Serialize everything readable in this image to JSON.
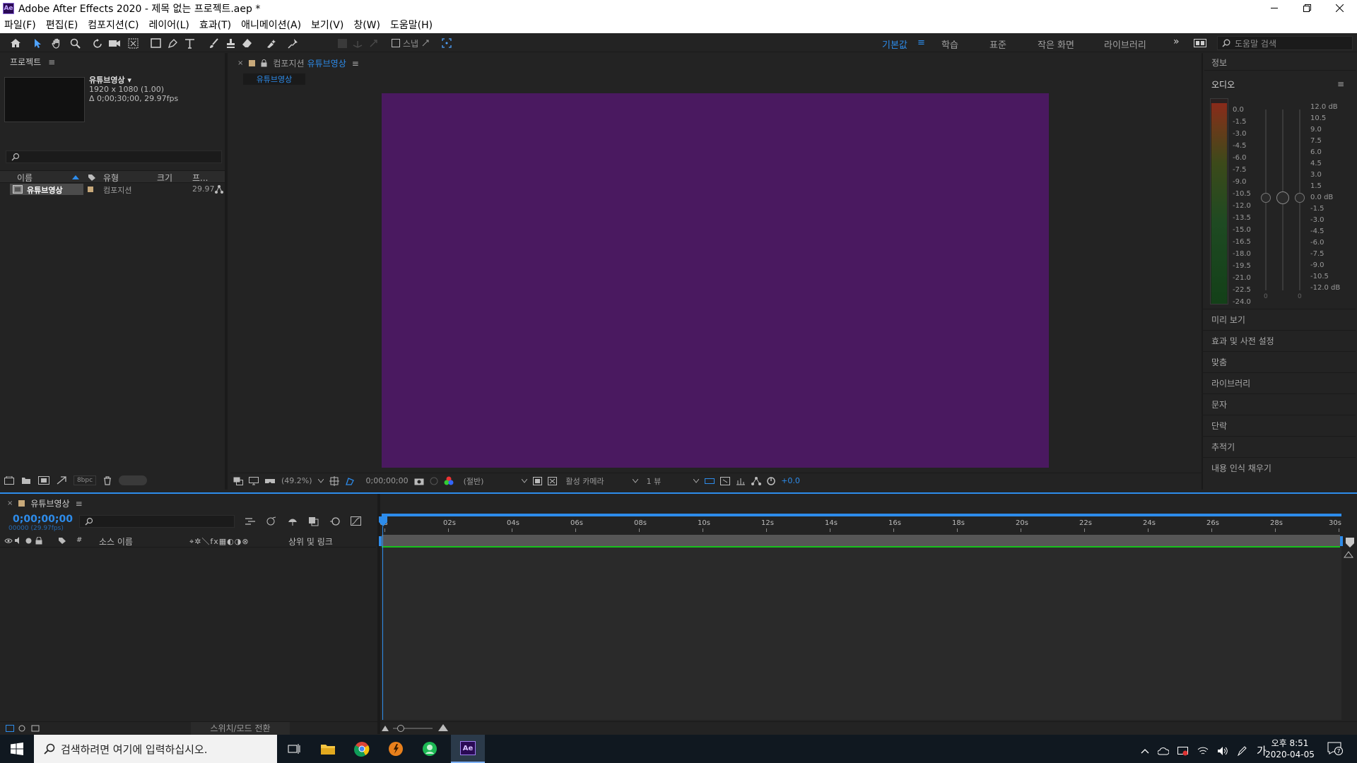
{
  "window": {
    "title": "Adobe After Effects 2020 - 제목 없는 프로젝트.aep *",
    "logo": "Ae"
  },
  "menu": [
    "파일(F)",
    "편집(E)",
    "컴포지션(C)",
    "레이어(L)",
    "효과(T)",
    "애니메이션(A)",
    "보기(V)",
    "창(W)",
    "도움말(H)"
  ],
  "toolbar": {
    "snap_label": "스냅",
    "workspaces": [
      "기본값",
      "학습",
      "표준",
      "작은 화면",
      "라이브러리"
    ],
    "active_workspace": "기본값",
    "search_placeholder": "도움말 검색"
  },
  "project": {
    "tab": "프로젝트",
    "item_name": "유튜브영상 ▾",
    "item_res": "1920 x 1080 (1.00)",
    "item_dur": "Δ 0;00;30;00, 29.97fps",
    "columns": [
      "이름",
      "유형",
      "크기",
      "프..."
    ],
    "rows": [
      {
        "name": "유튜브영상",
        "type": "컴포지션",
        "size": "",
        "fps": "29.97"
      }
    ],
    "bpc": "8bpc"
  },
  "composition": {
    "tab_prefix": "컴포지션",
    "tab_name": "유튜브영상",
    "subtab": "유튜브영상",
    "bg_color": "#4a1960",
    "zoom": "(49.2%)",
    "timecode": "0;00;00;00",
    "resolution": "(절반)",
    "camera": "활성 카메라",
    "views": "1 뷰",
    "exposure": "+0.0"
  },
  "right_panel": {
    "info": "정보",
    "audio": "오디오",
    "db_left": [
      "0.0",
      "-1.5",
      "-3.0",
      "-4.5",
      "-6.0",
      "-7.5",
      "-9.0",
      "-10.5",
      "-12.0",
      "-13.5",
      "-15.0",
      "-16.5",
      "-18.0",
      "-19.5",
      "-21.0",
      "-22.5",
      "-24.0"
    ],
    "db_right": [
      "12.0 dB",
      "10.5",
      "9.0",
      "7.5",
      "6.0",
      "4.5",
      "3.0",
      "1.5",
      "0.0 dB",
      "-1.5",
      "-3.0",
      "-4.5",
      "-6.0",
      "-7.5",
      "-9.0",
      "-10.5",
      "-12.0 dB"
    ],
    "slider_zero_left": "0",
    "slider_zero_right": "0",
    "sections": [
      "미리 보기",
      "효과 및 사전 설정",
      "맞춤",
      "라이브러리",
      "문자",
      "단락",
      "추적기",
      "내용 인식 채우기"
    ]
  },
  "timeline": {
    "tab": "유튜브영상",
    "timecode": "0;00;00;00",
    "frame_info": "00000 (29.97fps)",
    "col_num": "#",
    "col_source": "소스 이름",
    "col_parent": "상위 및 링크",
    "ticks": [
      "0s",
      "02s",
      "04s",
      "06s",
      "08s",
      "10s",
      "12s",
      "14s",
      "16s",
      "18s",
      "20s",
      "22s",
      "24s",
      "26s",
      "28s",
      "30s"
    ],
    "toggle_label": "스위치/모드 전환"
  },
  "taskbar": {
    "search_placeholder": "검색하려면 여기에 입력하십시오.",
    "time": "오후 8:51",
    "date": "2020-04-05",
    "ime": "가",
    "notif_count": "7",
    "ae": "Ae"
  }
}
